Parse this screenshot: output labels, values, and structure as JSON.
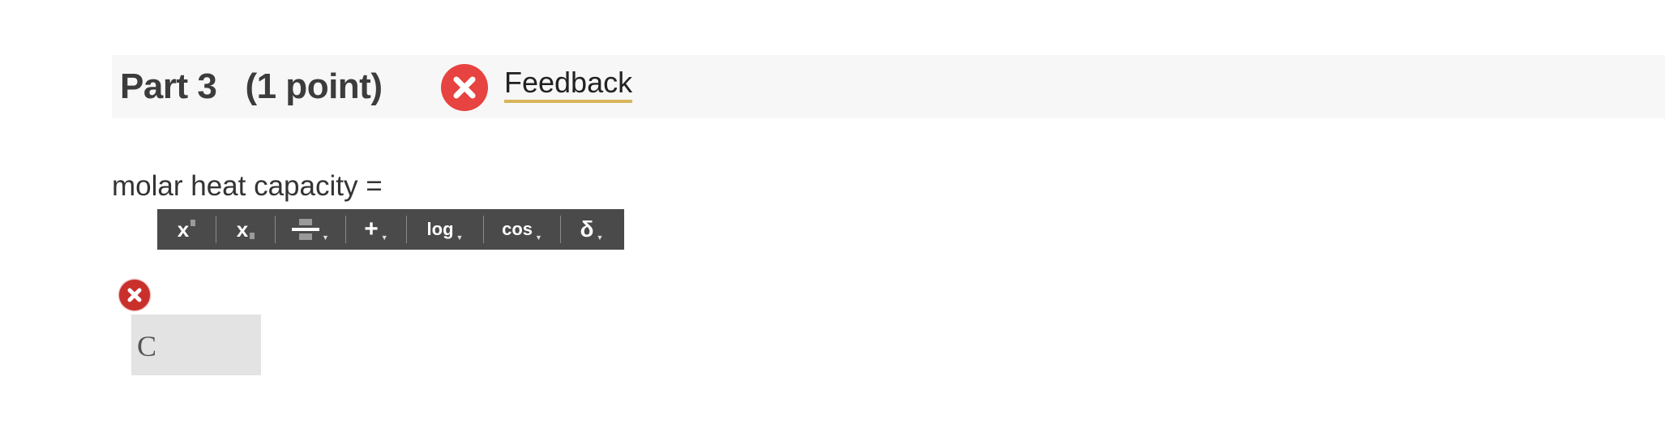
{
  "part": {
    "title": "Part 3   (1 point)",
    "feedback_label": "Feedback",
    "feedback_icon": "error-circle-icon",
    "accent_color": "#e74340",
    "link_underline_color": "#d8b65a"
  },
  "question": {
    "prompt": "molar heat capacity ="
  },
  "toolbar": {
    "buttons": [
      {
        "name": "superscript",
        "label": "x"
      },
      {
        "name": "subscript",
        "label": "x"
      },
      {
        "name": "fraction",
        "label": ""
      },
      {
        "name": "operators",
        "label": "+"
      },
      {
        "name": "log",
        "label": "log"
      },
      {
        "name": "trig",
        "label": "cos"
      },
      {
        "name": "greek",
        "label": "δ"
      }
    ]
  },
  "answer": {
    "value": "C",
    "status_icon": "error-icon",
    "status_color": "#c9302c"
  }
}
